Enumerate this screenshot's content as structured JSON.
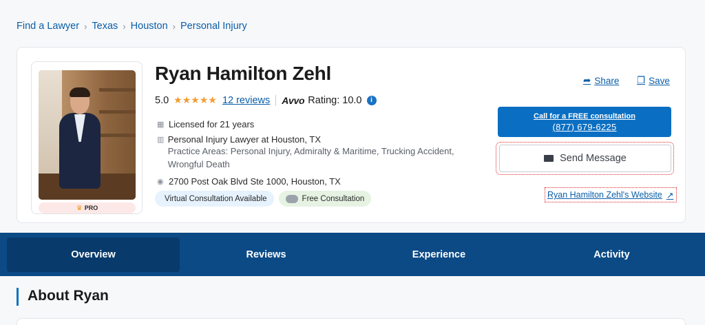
{
  "breadcrumb": [
    "Find a Lawyer",
    "Texas",
    "Houston",
    "Personal Injury"
  ],
  "profile": {
    "name": "Ryan Hamilton Zehl",
    "score": "5.0",
    "stars": "★★★★★",
    "reviews": "12 reviews",
    "avvo_brand": "Avvo",
    "avvo_rating": "Rating: 10.0",
    "pro_label": "PRO",
    "licensed": "Licensed for 21 years",
    "title": "Personal Injury Lawyer at Houston, TX",
    "practice_areas": "Practice Areas: Personal Injury, Admiralty & Maritime, Trucking Accident, Wrongful Death",
    "address": "2700 Post Oak Blvd Ste 1000, Houston, TX",
    "tags": [
      "Virtual Consultation Available",
      "Free Consultation"
    ]
  },
  "actions": {
    "share": "Share",
    "save": "Save",
    "call_line1": "Call for a FREE consultation",
    "call_line2": "(877) 679-6225",
    "send_message": "Send Message",
    "website": "Ryan Hamilton Zehl's Website"
  },
  "tabs": [
    "Overview",
    "Reviews",
    "Experience",
    "Activity"
  ],
  "section_title": "About Ryan",
  "colors": {
    "accent": "#0a6fc2",
    "link": "#0a5ea8",
    "nav": "#0b4a85",
    "star": "#f49b2e"
  }
}
